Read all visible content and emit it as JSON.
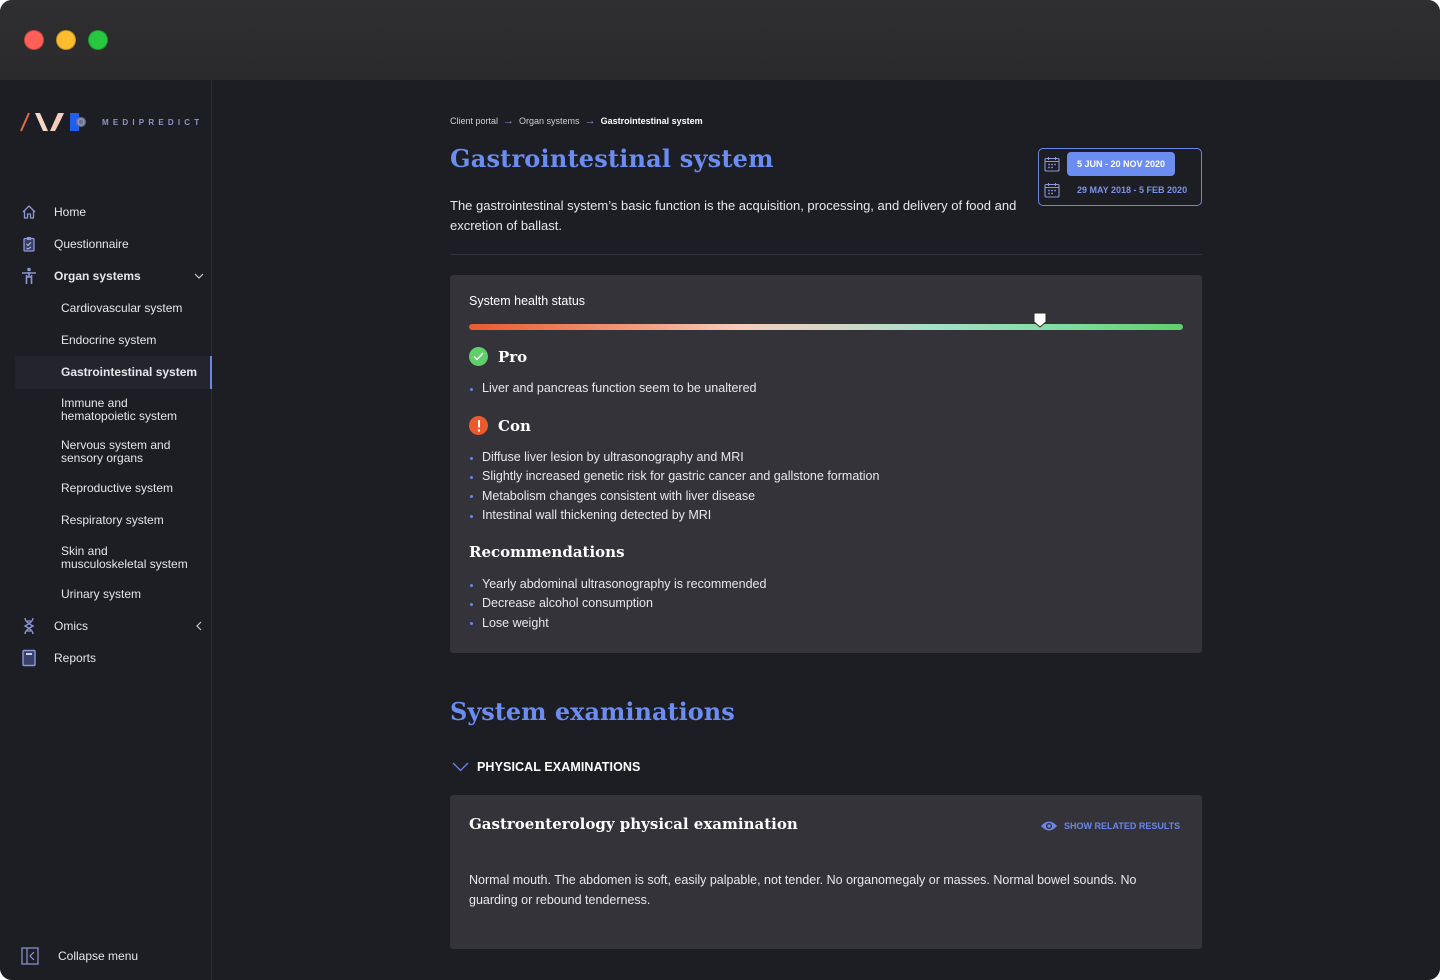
{
  "window": {
    "controls": [
      "close",
      "minimize",
      "maximize"
    ]
  },
  "brand": {
    "name": "MEDIPREDICT"
  },
  "sidebar": {
    "items": [
      {
        "label": "Home",
        "icon": "home-icon"
      },
      {
        "label": "Questionnaire",
        "icon": "clipboard-icon"
      },
      {
        "label": "Organ systems",
        "icon": "human-body-icon",
        "expanded": true
      },
      {
        "label": "Omics",
        "icon": "dna-icon",
        "expanded": false
      },
      {
        "label": "Reports",
        "icon": "report-icon"
      }
    ],
    "organ_systems": [
      {
        "label": "Cardiovascular system"
      },
      {
        "label": "Endocrine system"
      },
      {
        "label": "Gastrointestinal system",
        "active": true
      },
      {
        "label": "Immune and",
        "label2": "hematopoietic system"
      },
      {
        "label": "Nervous system and",
        "label2": "sensory organs"
      },
      {
        "label": "Reproductive system"
      },
      {
        "label": "Respiratory system"
      },
      {
        "label": "Skin and",
        "label2": "musculoskeletal system"
      },
      {
        "label": "Urinary system"
      }
    ],
    "collapse_label": "Collapse menu"
  },
  "breadcrumb": [
    "Client portal",
    "Organ systems",
    "Gastrointestinal system"
  ],
  "page": {
    "title": "Gastrointestinal system",
    "description": "The gastrointestinal system’s basic function is the acquisition, processing, and delivery of food and excretion of ballast."
  },
  "date_ranges": [
    {
      "label": "5 JUN - 20 NOV 2020",
      "selected": true
    },
    {
      "label": "29 MAY 2018 - 5 FEB 2020",
      "selected": false
    }
  ],
  "health": {
    "label": "System health status",
    "score": 0.8,
    "colors": {
      "bad": "#ea5a2e",
      "good": "#5fcf6a"
    },
    "pro": {
      "title": "Pro",
      "items": [
        "Liver and pancreas function seem to be unaltered"
      ]
    },
    "con": {
      "title": "Con",
      "items": [
        "Diffuse liver lesion by ultrasonography and MRI",
        "Slightly increased genetic risk for gastric cancer and gallstone formation",
        "Metabolism changes consistent with liver disease",
        "Intestinal wall thickening detected by MRI"
      ]
    },
    "recommendations": {
      "title": "Recommendations",
      "items": [
        "Yearly abdominal ultrasonography is recommended",
        "Decrease alcohol consumption",
        "Lose weight"
      ]
    }
  },
  "examinations": {
    "title": "System examinations",
    "group_label": "PHYSICAL EXAMINATIONS",
    "cards": [
      {
        "title": "Gastroenterology physical examination",
        "action_label": "SHOW RELATED RESULTS",
        "text": "Normal mouth. The abdomen is soft, easily palpable, not tender. No organomegaly or masses. Normal bowel sounds. No guarding or rebound tenderness."
      }
    ]
  },
  "accent_color": "#6b8cf0"
}
